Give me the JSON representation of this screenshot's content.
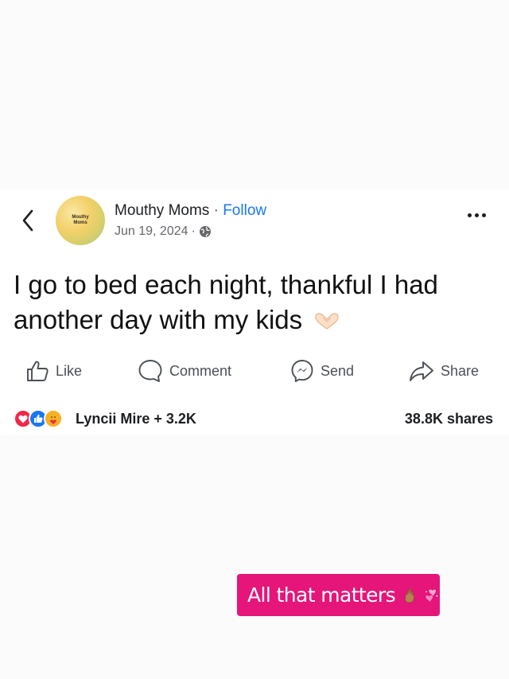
{
  "post": {
    "author": "Mouthy Moms",
    "separator": "·",
    "follow_label": "Follow",
    "date": "Jun 19, 2024",
    "date_separator": "·",
    "avatar_text": "Mouthy Moms",
    "body": "I go to bed each night, thankful I had another day with my kids",
    "body_emoji": "heart-hands-emoji",
    "actions": {
      "like": "Like",
      "comment": "Comment",
      "send": "Send",
      "share": "Share"
    },
    "reactions": [
      "love",
      "like",
      "care"
    ],
    "reactor_summary": "Lyncii Mire + 3.2K",
    "shares": "38.8K shares"
  },
  "caption": {
    "text": "All that matters",
    "emojis": [
      "crossed-fingers-emoji",
      "two-hearts-emoji"
    ]
  },
  "colors": {
    "follow": "#1877f2",
    "caption_bg": "#e5157a",
    "love": "#f02849",
    "like": "#1877f2",
    "care": "#f7b125"
  }
}
